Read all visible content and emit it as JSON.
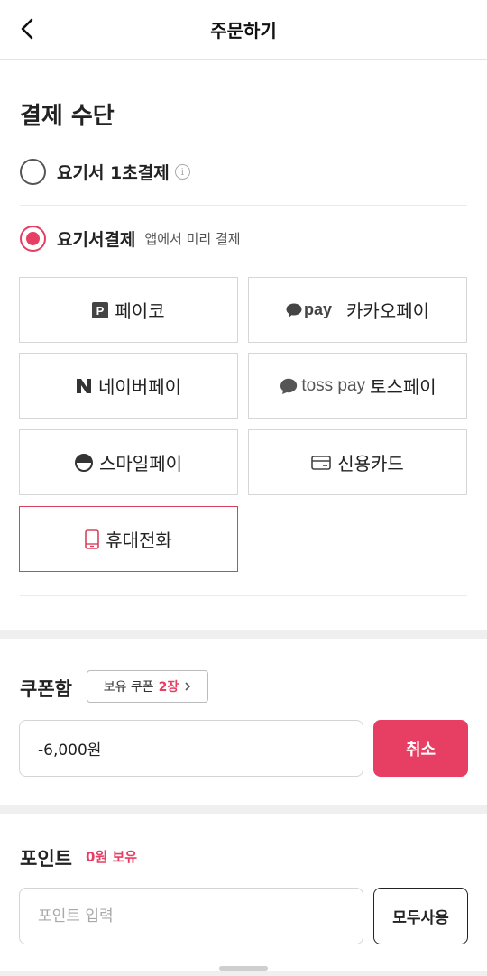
{
  "header": {
    "title": "주문하기",
    "back_icon": "chevron-left-icon"
  },
  "payment": {
    "title": "결제 수단",
    "option_quick": {
      "label": "요기서 1초결제",
      "selected": false,
      "info_icon": "info-icon"
    },
    "option_yogiseo": {
      "label": "요기서결제",
      "sub": "앱에서 미리 결제",
      "selected": true
    },
    "methods": [
      {
        "label": "페이코",
        "icon": "payco-icon",
        "selected": false
      },
      {
        "label": "카카오페이",
        "icon": "kakaopay-icon",
        "logo_text": "pay",
        "selected": false
      },
      {
        "label": "네이버페이",
        "icon": "naverpay-icon",
        "selected": false
      },
      {
        "label": "토스페이",
        "icon": "tosspay-icon",
        "logo_text": "toss pay",
        "selected": false
      },
      {
        "label": "스마일페이",
        "icon": "smilepay-icon",
        "selected": false
      },
      {
        "label": "신용카드",
        "icon": "credit-card-icon",
        "selected": false
      },
      {
        "label": "휴대전화",
        "icon": "mobile-phone-icon",
        "selected": true
      }
    ]
  },
  "coupon": {
    "title": "쿠폰함",
    "badge_prefix": "보유 쿠폰",
    "badge_count": "2장",
    "value": "-6,000원",
    "cancel_label": "취소"
  },
  "point": {
    "title": "포인트",
    "owned": "0원 보유",
    "placeholder": "포인트 입력",
    "use_all_label": "모두사용"
  },
  "colors": {
    "accent": "#e63f63",
    "border": "#d6d6d6",
    "band": "#efefef"
  }
}
